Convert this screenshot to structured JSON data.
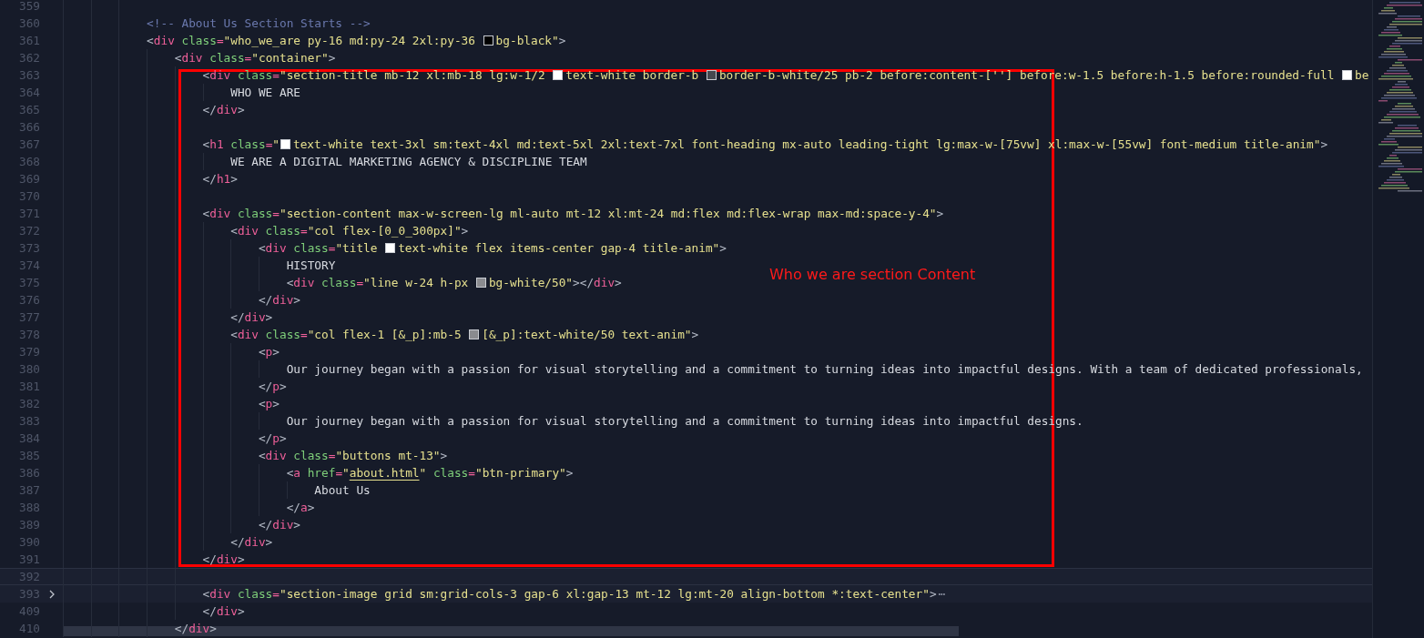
{
  "editor": {
    "lines": [
      {
        "n": "359"
      },
      {
        "n": "360",
        "tokens": [
          {
            "kind": "comment",
            "text": "            <!-- About Us Section Starts -->"
          }
        ]
      },
      {
        "n": "361",
        "tokens": [
          {
            "kind": "punct",
            "text": "            <"
          },
          {
            "kind": "tag",
            "text": "div"
          },
          {
            "kind": "attr",
            "text": " class"
          },
          {
            "kind": "equals",
            "text": "="
          },
          {
            "kind": "string",
            "text": "\"who_we_are py-16 md:py-24 2xl:py-36 "
          },
          {
            "kind": "swatch",
            "color": "#000000"
          },
          {
            "kind": "string",
            "text": "bg-black\""
          },
          {
            "kind": "punct",
            "text": ">"
          }
        ]
      },
      {
        "n": "362",
        "tokens": [
          {
            "kind": "punct",
            "text": "                <"
          },
          {
            "kind": "tag",
            "text": "div"
          },
          {
            "kind": "attr",
            "text": " class"
          },
          {
            "kind": "equals",
            "text": "="
          },
          {
            "kind": "string",
            "text": "\"container\""
          },
          {
            "kind": "punct",
            "text": ">"
          }
        ]
      },
      {
        "n": "363",
        "tokens": [
          {
            "kind": "punct",
            "text": "                    <"
          },
          {
            "kind": "tag",
            "text": "div"
          },
          {
            "kind": "attr",
            "text": " class"
          },
          {
            "kind": "equals",
            "text": "="
          },
          {
            "kind": "string",
            "text": "\"section-title mb-12 xl:mb-18 lg:w-1/2 "
          },
          {
            "kind": "swatch",
            "color": "#ffffff"
          },
          {
            "kind": "string",
            "text": "text-white border-b "
          },
          {
            "kind": "swatch",
            "color": "#45484f"
          },
          {
            "kind": "string",
            "text": "border-b-white/25 pb-2 before:content-[''] before:w-1.5 before:h-1.5 before:rounded-full "
          },
          {
            "kind": "swatch",
            "color": "#ffffff"
          },
          {
            "kind": "string",
            "text": "be"
          }
        ]
      },
      {
        "n": "364",
        "tokens": [
          {
            "kind": "text",
            "text": "                        WHO WE ARE"
          }
        ]
      },
      {
        "n": "365",
        "tokens": [
          {
            "kind": "punct",
            "text": "                    </"
          },
          {
            "kind": "tag",
            "text": "div"
          },
          {
            "kind": "punct",
            "text": ">"
          }
        ]
      },
      {
        "n": "366"
      },
      {
        "n": "367",
        "tokens": [
          {
            "kind": "punct",
            "text": "                    <"
          },
          {
            "kind": "tag",
            "text": "h1"
          },
          {
            "kind": "attr",
            "text": " class"
          },
          {
            "kind": "equals",
            "text": "="
          },
          {
            "kind": "string",
            "text": "\""
          },
          {
            "kind": "swatch",
            "color": "#ffffff"
          },
          {
            "kind": "string",
            "text": "text-white text-3xl sm:text-4xl md:text-5xl 2xl:text-7xl font-heading mx-auto leading-tight lg:max-w-[75vw] xl:max-w-[55vw] font-medium title-anim\""
          },
          {
            "kind": "punct",
            "text": ">"
          }
        ]
      },
      {
        "n": "368",
        "tokens": [
          {
            "kind": "text",
            "text": "                        WE ARE A DIGITAL MARKETING AGENCY & DISCIPLINE TEAM"
          }
        ]
      },
      {
        "n": "369",
        "tokens": [
          {
            "kind": "punct",
            "text": "                    </"
          },
          {
            "kind": "tag",
            "text": "h1"
          },
          {
            "kind": "punct",
            "text": ">"
          }
        ]
      },
      {
        "n": "370"
      },
      {
        "n": "371",
        "tokens": [
          {
            "kind": "punct",
            "text": "                    <"
          },
          {
            "kind": "tag",
            "text": "div"
          },
          {
            "kind": "attr",
            "text": " class"
          },
          {
            "kind": "equals",
            "text": "="
          },
          {
            "kind": "string",
            "text": "\"section-content max-w-screen-lg ml-auto mt-12 xl:mt-24 md:flex md:flex-wrap max-md:space-y-4\""
          },
          {
            "kind": "punct",
            "text": ">"
          }
        ]
      },
      {
        "n": "372",
        "tokens": [
          {
            "kind": "punct",
            "text": "                        <"
          },
          {
            "kind": "tag",
            "text": "div"
          },
          {
            "kind": "attr",
            "text": " class"
          },
          {
            "kind": "equals",
            "text": "="
          },
          {
            "kind": "string",
            "text": "\"col flex-[0_0_300px]\""
          },
          {
            "kind": "punct",
            "text": ">"
          }
        ]
      },
      {
        "n": "373",
        "tokens": [
          {
            "kind": "punct",
            "text": "                            <"
          },
          {
            "kind": "tag",
            "text": "div"
          },
          {
            "kind": "attr",
            "text": " class"
          },
          {
            "kind": "equals",
            "text": "="
          },
          {
            "kind": "string",
            "text": "\"title "
          },
          {
            "kind": "swatch",
            "color": "#ffffff"
          },
          {
            "kind": "string",
            "text": "text-white flex items-center gap-4 title-anim\""
          },
          {
            "kind": "punct",
            "text": ">"
          }
        ]
      },
      {
        "n": "374",
        "tokens": [
          {
            "kind": "text",
            "text": "                                HISTORY"
          }
        ]
      },
      {
        "n": "375",
        "tokens": [
          {
            "kind": "punct",
            "text": "                                <"
          },
          {
            "kind": "tag",
            "text": "div"
          },
          {
            "kind": "attr",
            "text": " class"
          },
          {
            "kind": "equals",
            "text": "="
          },
          {
            "kind": "string",
            "text": "\"line w-24 h-px "
          },
          {
            "kind": "swatch",
            "color": "#8a8b8f"
          },
          {
            "kind": "string",
            "text": "bg-white/50\""
          },
          {
            "kind": "punct",
            "text": "></"
          },
          {
            "kind": "tag",
            "text": "div"
          },
          {
            "kind": "punct",
            "text": ">"
          }
        ]
      },
      {
        "n": "376",
        "tokens": [
          {
            "kind": "punct",
            "text": "                            </"
          },
          {
            "kind": "tag",
            "text": "div"
          },
          {
            "kind": "punct",
            "text": ">"
          }
        ]
      },
      {
        "n": "377",
        "tokens": [
          {
            "kind": "punct",
            "text": "                        </"
          },
          {
            "kind": "tag",
            "text": "div"
          },
          {
            "kind": "punct",
            "text": ">"
          }
        ]
      },
      {
        "n": "378",
        "tokens": [
          {
            "kind": "punct",
            "text": "                        <"
          },
          {
            "kind": "tag",
            "text": "div"
          },
          {
            "kind": "attr",
            "text": " class"
          },
          {
            "kind": "equals",
            "text": "="
          },
          {
            "kind": "string",
            "text": "\"col flex-1 [&_p]:mb-5 "
          },
          {
            "kind": "swatch",
            "color": "#8a8b8f"
          },
          {
            "kind": "string",
            "text": "[&_p]:text-white/50 text-anim\""
          },
          {
            "kind": "punct",
            "text": ">"
          }
        ]
      },
      {
        "n": "379",
        "tokens": [
          {
            "kind": "punct",
            "text": "                            <"
          },
          {
            "kind": "tag",
            "text": "p"
          },
          {
            "kind": "punct",
            "text": ">"
          }
        ]
      },
      {
        "n": "380",
        "tokens": [
          {
            "kind": "text",
            "text": "                                Our journey began with a passion for visual storytelling and a commitment to turning ideas into impactful designs. With a team of dedicated professionals,"
          }
        ]
      },
      {
        "n": "381",
        "tokens": [
          {
            "kind": "punct",
            "text": "                            </"
          },
          {
            "kind": "tag",
            "text": "p"
          },
          {
            "kind": "punct",
            "text": ">"
          }
        ]
      },
      {
        "n": "382",
        "tokens": [
          {
            "kind": "punct",
            "text": "                            <"
          },
          {
            "kind": "tag",
            "text": "p"
          },
          {
            "kind": "punct",
            "text": ">"
          }
        ]
      },
      {
        "n": "383",
        "tokens": [
          {
            "kind": "text",
            "text": "                                Our journey began with a passion for visual storytelling and a commitment to turning ideas into impactful designs."
          }
        ]
      },
      {
        "n": "384",
        "tokens": [
          {
            "kind": "punct",
            "text": "                            </"
          },
          {
            "kind": "tag",
            "text": "p"
          },
          {
            "kind": "punct",
            "text": ">"
          }
        ]
      },
      {
        "n": "385",
        "tokens": [
          {
            "kind": "punct",
            "text": "                            <"
          },
          {
            "kind": "tag",
            "text": "div"
          },
          {
            "kind": "attr",
            "text": " class"
          },
          {
            "kind": "equals",
            "text": "="
          },
          {
            "kind": "string",
            "text": "\"buttons mt-13\""
          },
          {
            "kind": "punct",
            "text": ">"
          }
        ]
      },
      {
        "n": "386",
        "tokens": [
          {
            "kind": "punct",
            "text": "                                <"
          },
          {
            "kind": "tag",
            "text": "a"
          },
          {
            "kind": "attr",
            "text": " href"
          },
          {
            "kind": "equals",
            "text": "="
          },
          {
            "kind": "string",
            "text": "\""
          },
          {
            "kind": "link",
            "text": "about.html"
          },
          {
            "kind": "string",
            "text": "\""
          },
          {
            "kind": "attr",
            "text": " class"
          },
          {
            "kind": "equals",
            "text": "="
          },
          {
            "kind": "string",
            "text": "\"btn-primary\""
          },
          {
            "kind": "punct",
            "text": ">"
          }
        ]
      },
      {
        "n": "387",
        "tokens": [
          {
            "kind": "text",
            "text": "                                    About Us"
          }
        ]
      },
      {
        "n": "388",
        "tokens": [
          {
            "kind": "punct",
            "text": "                                </"
          },
          {
            "kind": "tag",
            "text": "a"
          },
          {
            "kind": "punct",
            "text": ">"
          }
        ]
      },
      {
        "n": "389",
        "tokens": [
          {
            "kind": "punct",
            "text": "                            </"
          },
          {
            "kind": "tag",
            "text": "div"
          },
          {
            "kind": "punct",
            "text": ">"
          }
        ]
      },
      {
        "n": "390",
        "tokens": [
          {
            "kind": "punct",
            "text": "                        </"
          },
          {
            "kind": "tag",
            "text": "div"
          },
          {
            "kind": "punct",
            "text": ">"
          }
        ]
      },
      {
        "n": "391",
        "tokens": [
          {
            "kind": "punct",
            "text": "                    </"
          },
          {
            "kind": "tag",
            "text": "div"
          },
          {
            "kind": "punct",
            "text": ">"
          }
        ]
      },
      {
        "n": "392",
        "current": true
      },
      {
        "n": "393",
        "folded": true,
        "tokens": [
          {
            "kind": "punct",
            "text": "                    <"
          },
          {
            "kind": "tag",
            "text": "div"
          },
          {
            "kind": "attr",
            "text": " class"
          },
          {
            "kind": "equals",
            "text": "="
          },
          {
            "kind": "string",
            "text": "\"section-image grid sm:grid-cols-3 gap-6 xl:gap-13 mt-12 lg:mt-20 align-bottom *:text-center\""
          },
          {
            "kind": "punct",
            "text": ">"
          },
          {
            "kind": "fold",
            "text": "⋯"
          }
        ]
      },
      {
        "n": "409",
        "tokens": [
          {
            "kind": "punct",
            "text": "                    </"
          },
          {
            "kind": "tag",
            "text": "div"
          },
          {
            "kind": "punct",
            "text": ">"
          }
        ]
      },
      {
        "n": "410",
        "tokens": [
          {
            "kind": "punct",
            "text": "                </"
          },
          {
            "kind": "tag",
            "text": "div"
          },
          {
            "kind": "punct",
            "text": ">"
          }
        ]
      }
    ]
  },
  "annotation": {
    "label": "Who we are section Content"
  }
}
